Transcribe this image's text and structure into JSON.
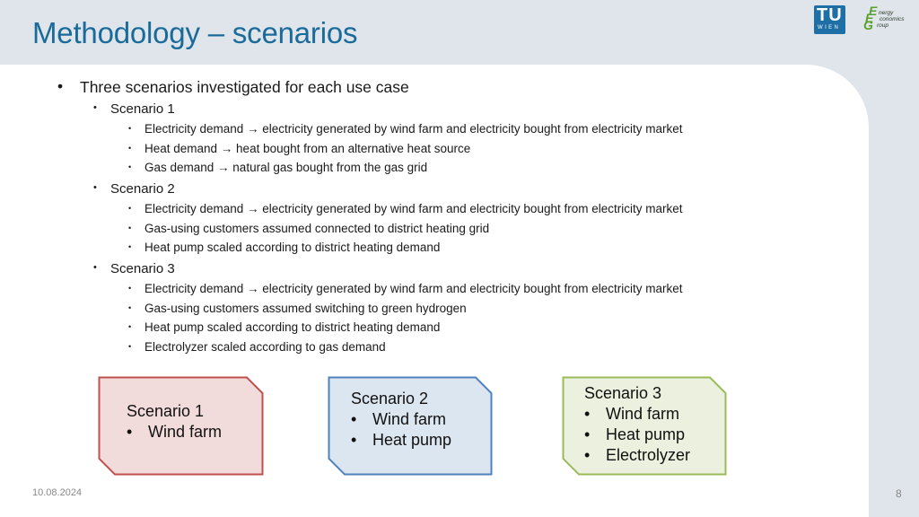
{
  "slide": {
    "title": "Methodology – scenarios",
    "logos": {
      "tu_wien": {
        "top": "TU",
        "bottom": "WIEN"
      },
      "eeg": {
        "letters": [
          "E",
          "E",
          "G"
        ],
        "words": [
          "nergy",
          "conomics",
          "roup"
        ]
      }
    },
    "bullets": {
      "main": "Three scenarios investigated for each use case",
      "scenarios": [
        {
          "label": "Scenario 1",
          "items": [
            "Electricity demand → electricity generated by wind farm and electricity bought from electricity market",
            "Heat demand → heat bought from an alternative heat source",
            "Gas demand → natural gas bought from the gas grid"
          ]
        },
        {
          "label": "Scenario 2",
          "items": [
            "Electricity demand → electricity generated by wind farm and electricity bought from electricity market",
            "Gas-using customers assumed connected to district heating grid",
            "Heat pump scaled according to district heating demand"
          ]
        },
        {
          "label": "Scenario 3",
          "items": [
            "Electricity demand → electricity generated by wind farm and electricity bought from electricity market",
            "Gas-using customers assumed switching to green hydrogen",
            "Heat pump scaled according to district heating demand",
            "Electrolyzer scaled according to gas demand"
          ]
        }
      ]
    },
    "boxes": [
      {
        "title": "Scenario 1",
        "items": [
          "Wind farm"
        ],
        "fill": "#f2dcdb",
        "stroke": "#c0504d"
      },
      {
        "title": "Scenario 2",
        "items": [
          "Wind farm",
          "Heat pump"
        ],
        "fill": "#dce6f1",
        "stroke": "#4f81bd"
      },
      {
        "title": "Scenario 3",
        "items": [
          "Wind farm",
          "Heat pump",
          "Electrolyzer"
        ],
        "fill": "#ebf1de",
        "stroke": "#9bbb59"
      }
    ],
    "bullet_glyph": "•",
    "footer": {
      "date": "10.08.2024",
      "page": "8"
    },
    "colors": {
      "title": "#1a6a9a",
      "background": "#dfe5ea",
      "panel": "#ffffff"
    }
  }
}
